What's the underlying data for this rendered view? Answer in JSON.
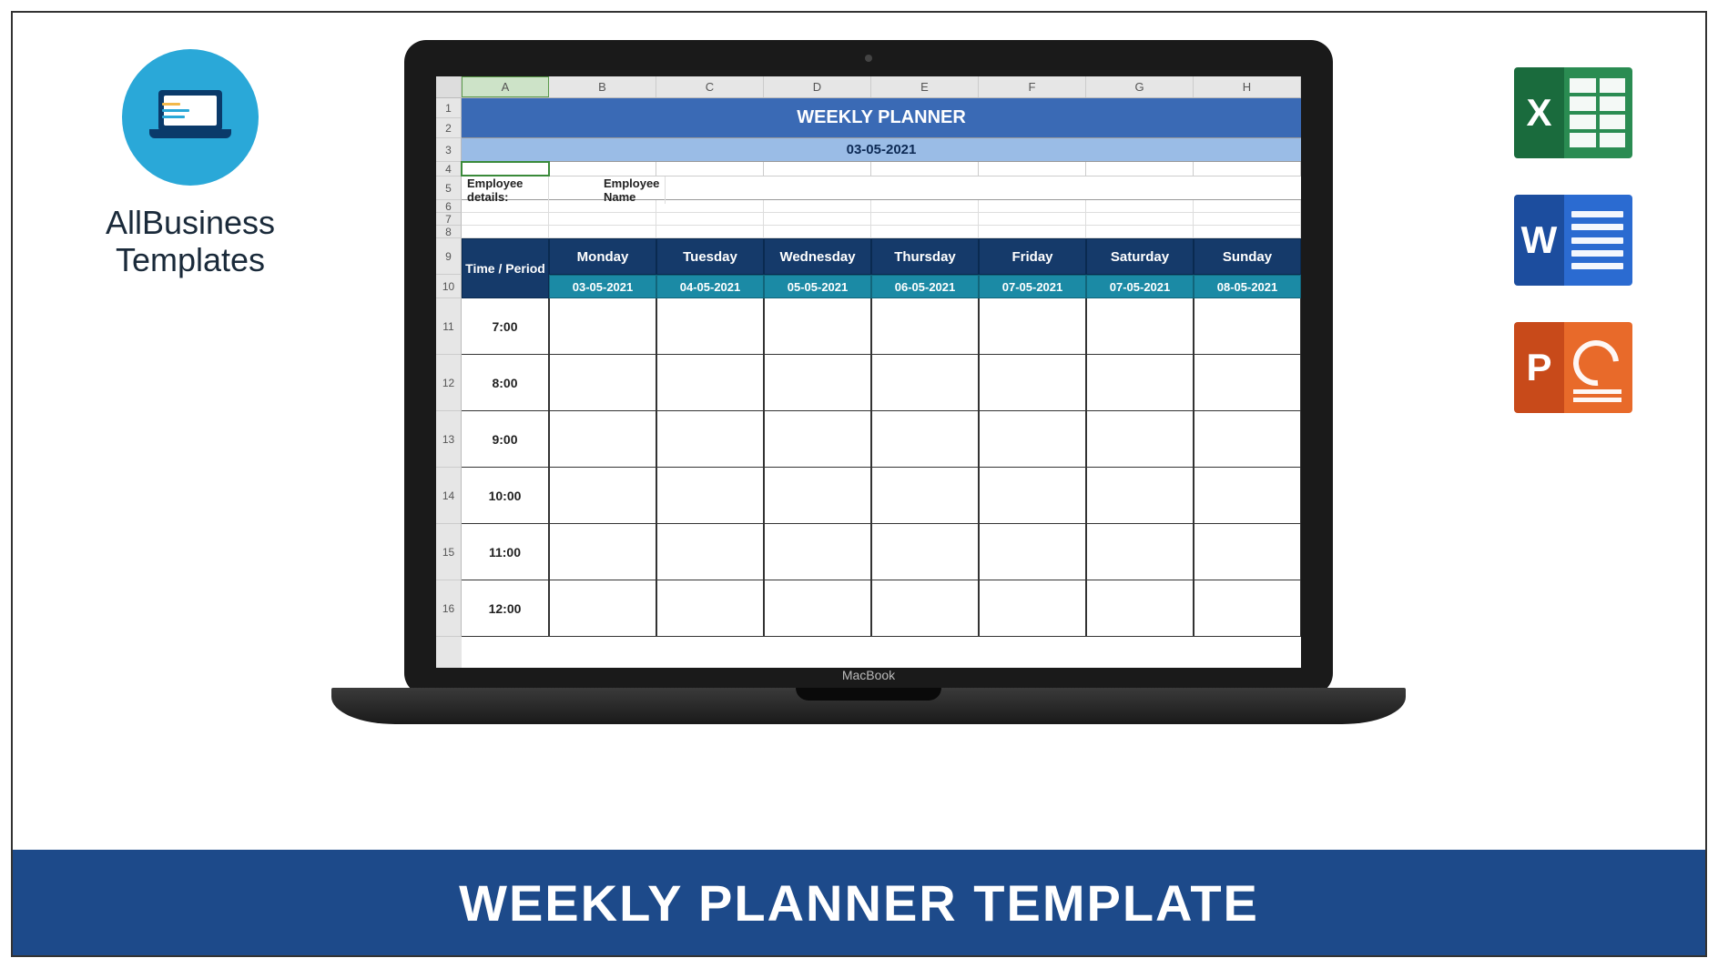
{
  "brand": {
    "line1": "AllBusiness",
    "line2": "Templates"
  },
  "office_icons": {
    "excel_letter": "X",
    "word_letter": "W",
    "ppt_letter": "P"
  },
  "footer_title": "WEEKLY PLANNER TEMPLATE",
  "mac_brand": "MacBook",
  "spreadsheet": {
    "columns": [
      "A",
      "B",
      "C",
      "D",
      "E",
      "F",
      "G",
      "H"
    ],
    "row_numbers": [
      "1",
      "2",
      "3",
      "4",
      "5",
      "6",
      "7",
      "8",
      "9",
      "10",
      "11",
      "12",
      "13",
      "14",
      "15",
      "16"
    ],
    "title": "WEEKLY PLANNER",
    "title_date": "03-05-2021",
    "employee_label": "Employee details:",
    "employee_name_label": "Employee Name",
    "time_period_header": "Time / Period",
    "days": [
      "Monday",
      "Tuesday",
      "Wednesday",
      "Thursday",
      "Friday",
      "Saturday",
      "Sunday"
    ],
    "dates": [
      "03-05-2021",
      "04-05-2021",
      "05-05-2021",
      "06-05-2021",
      "07-05-2021",
      "07-05-2021",
      "08-05-2021"
    ],
    "times": [
      "7:00",
      "8:00",
      "9:00",
      "10:00",
      "11:00",
      "12:00"
    ]
  }
}
